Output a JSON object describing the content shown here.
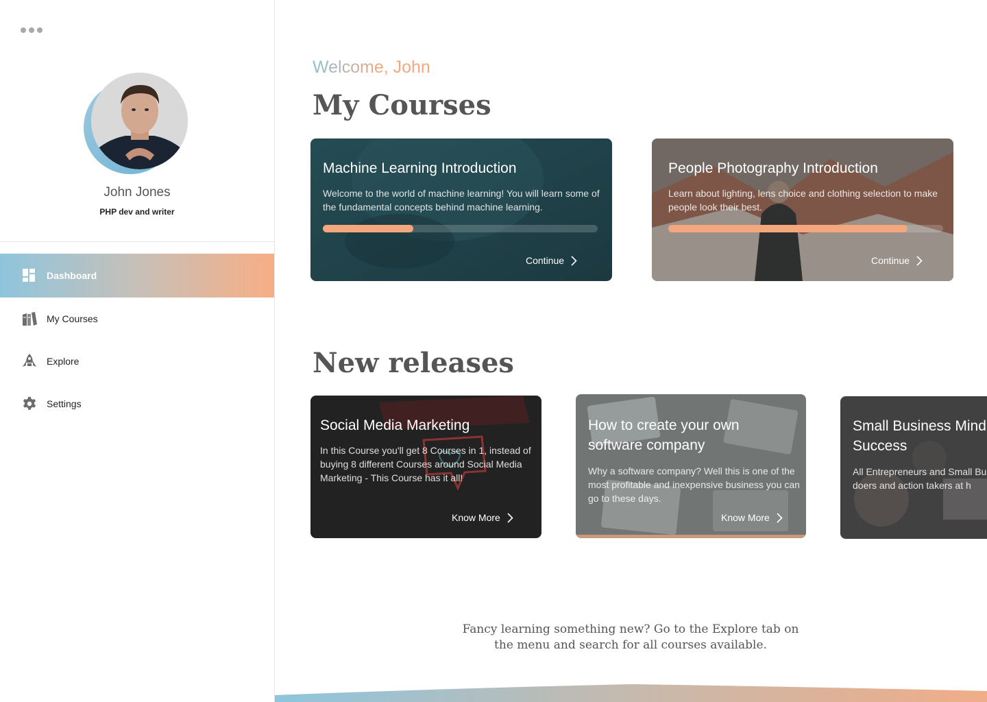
{
  "sidebar": {
    "user": {
      "name": "John Jones",
      "role": "PHP dev and writer"
    },
    "nav": [
      {
        "label": "Dashboard",
        "icon": "dashboard-icon",
        "active": true
      },
      {
        "label": "My Courses",
        "icon": "books-icon",
        "active": false
      },
      {
        "label": "Explore",
        "icon": "rocket-icon",
        "active": false
      },
      {
        "label": "Settings",
        "icon": "gear-icon",
        "active": false
      }
    ]
  },
  "main": {
    "welcome": "Welcome, John",
    "my_courses_title": "My Courses",
    "my_courses": [
      {
        "title": "Machine Learning Introduction",
        "description": "Welcome to the world of machine learning! You will learn some of the fundamental concepts behind machine learning.",
        "progress": 0.33,
        "cta": "Continue"
      },
      {
        "title": "People Photography Introduction",
        "description": "Learn about lighting, lens choice and clothing selection to make people look their best.",
        "progress": 0.87,
        "cta": "Continue"
      }
    ],
    "new_releases_title": "New releases",
    "new_releases": [
      {
        "title": "Social Media Marketing",
        "description": "In this Course you'll get 8 Courses in 1, instead of buying 8 different Courses around Social Media Marketing - This Course has it all!",
        "cta": "Know More"
      },
      {
        "title": "How to create your own software company",
        "description": "Why a software company? Well this is one of the most profitable and inexpensive business you can go to these days.",
        "cta": "Know More"
      },
      {
        "title": "Small Business Mind Success",
        "description": "All Entrepreneurs and Small Bu are doers and action takers at h",
        "cta": ""
      }
    ],
    "footer_note": "Fancy learning something new? Go to the Explore tab on the menu and search for all courses available."
  },
  "colors": {
    "accent_orange": "#f4a67c",
    "accent_blue": "#8cc0d6",
    "text_gray": "#555555"
  }
}
